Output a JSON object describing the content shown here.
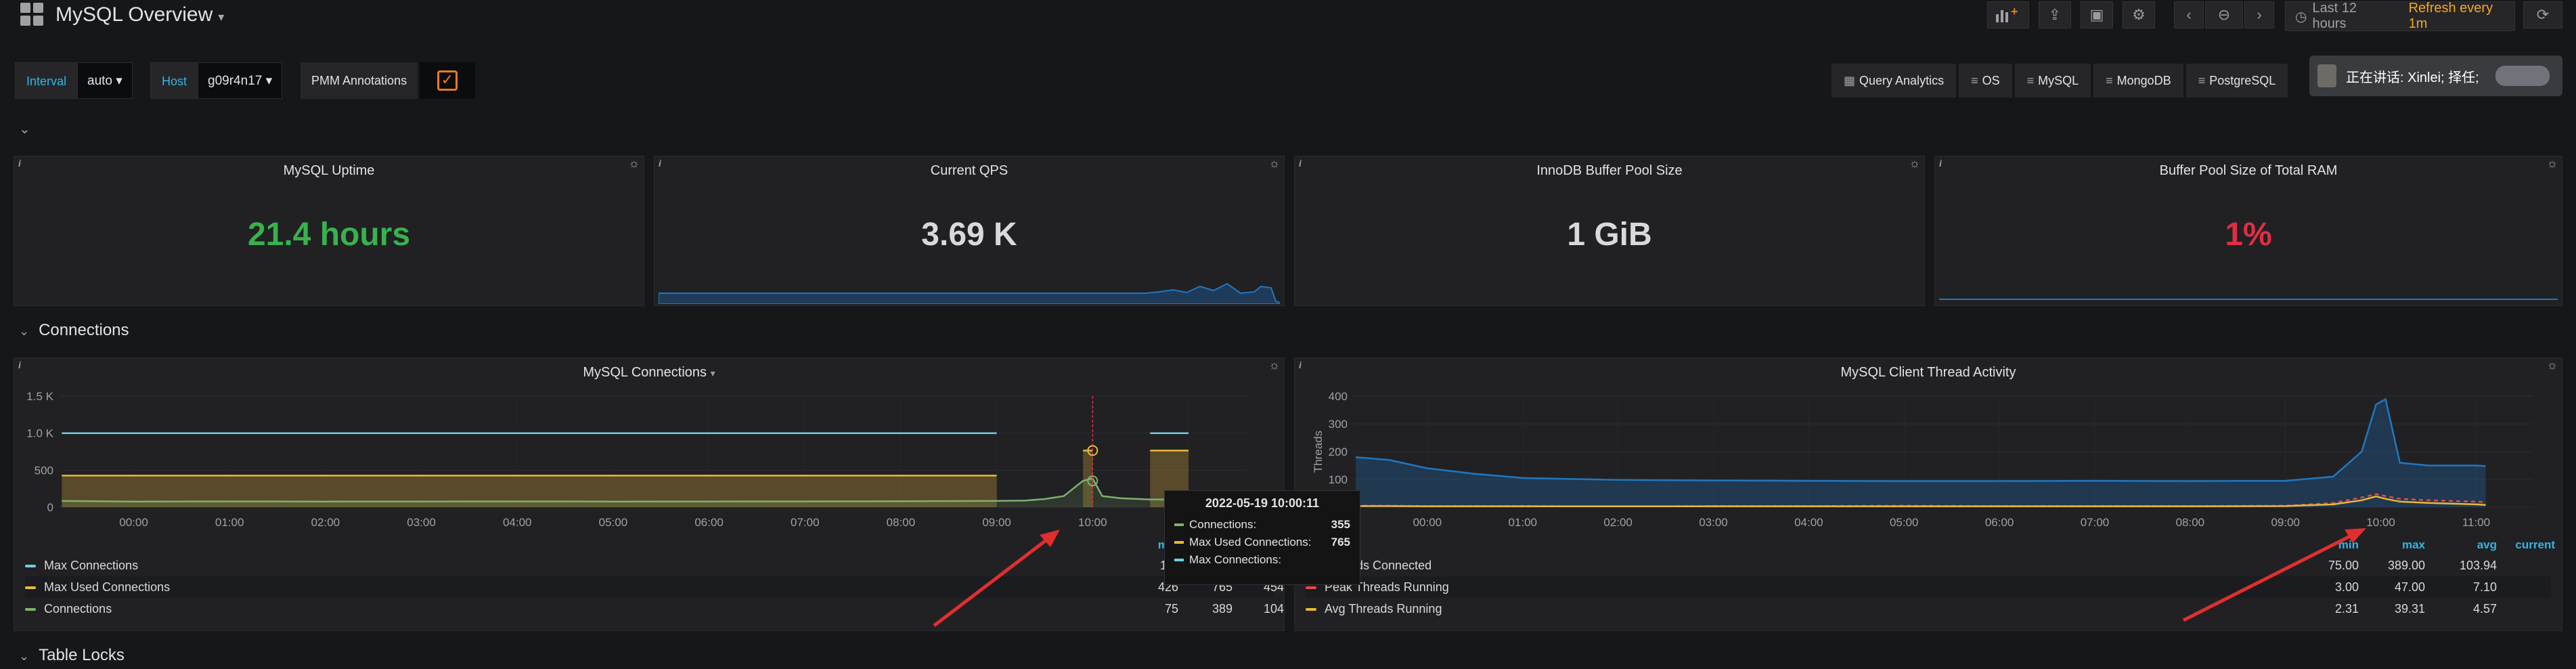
{
  "header": {
    "title": "MySQL Overview",
    "time_range": "Last 12 hours",
    "refresh": "Refresh every 1m"
  },
  "variables": {
    "interval_label": "Interval",
    "interval_value": "auto",
    "host_label": "Host",
    "host_value": "g09r4n17",
    "annotations_label": "PMM Annotations"
  },
  "nav_links": [
    "Query Analytics",
    "OS",
    "MySQL",
    "MongoDB",
    "PostgreSQL"
  ],
  "video_overlay": "正在讲话: Xinlei; 择任;",
  "stats": [
    {
      "title": "MySQL Uptime",
      "value": "21.4 hours",
      "color": "#37b24d"
    },
    {
      "title": "Current QPS",
      "value": "3.69 K",
      "color": "#d8d9da"
    },
    {
      "title": "InnoDB Buffer Pool Size",
      "value": "1 GiB",
      "color": "#d8d9da"
    },
    {
      "title": "Buffer Pool Size of Total RAM",
      "value": "1%",
      "color": "#e02f44"
    }
  ],
  "rows": {
    "connections": "Connections",
    "table_locks": "Table Locks"
  },
  "chart_data": [
    {
      "type": "line",
      "title": "MySQL Connections",
      "y_ticks": [
        "1.5 K",
        "1.0 K",
        "500",
        "0"
      ],
      "ylim": [
        0,
        1500
      ],
      "x_ticks": [
        "00:00",
        "01:00",
        "02:00",
        "03:00",
        "04:00",
        "05:00",
        "06:00",
        "07:00",
        "08:00",
        "09:00",
        "10:00",
        "11:00"
      ],
      "x_hours": [
        -0.75,
        0,
        1,
        2,
        3,
        4,
        5,
        6,
        7,
        8,
        9,
        9.3,
        9.5,
        9.7,
        9.9,
        10.0,
        10.1,
        10.3,
        10.6,
        11.0,
        11.2
      ],
      "series": [
        {
          "name": "Max Connections",
          "color": "#6ed0e0",
          "values": [
            1000,
            1000,
            1000,
            1000,
            1000,
            1000,
            1000,
            1000,
            1000,
            1000,
            1000,
            null,
            null,
            null,
            null,
            null,
            null,
            null,
            1000,
            1000,
            null
          ]
        },
        {
          "name": "Max Used Connections",
          "color": "#eab839",
          "values": [
            426,
            426,
            426,
            426,
            426,
            426,
            426,
            426,
            426,
            426,
            426,
            null,
            454,
            null,
            765,
            765,
            null,
            null,
            765,
            765,
            null
          ]
        },
        {
          "name": "Connections",
          "color": "#7eb26d",
          "values": [
            85,
            75,
            78,
            76,
            77,
            78,
            76,
            77,
            78,
            80,
            85,
            90,
            110,
            150,
            355,
            389,
            150,
            120,
            104,
            104,
            104
          ]
        }
      ],
      "legend_headers": [
        "min",
        "max",
        "avg"
      ],
      "legend": [
        {
          "name": "Max Connections",
          "min": "1 K",
          "max": "1 K",
          "avg": "1 K"
        },
        {
          "name": "Max Used Connections",
          "min": "426",
          "max": "765",
          "avg": "454"
        },
        {
          "name": "Connections",
          "min": "75",
          "max": "389",
          "avg": "104"
        }
      ],
      "tooltip": {
        "time": "2022-05-19 10:00:11",
        "items": [
          {
            "name": "Connections:",
            "value": "355",
            "color": "#7eb26d"
          },
          {
            "name": "Max Used Connections:",
            "value": "765",
            "color": "#eab839"
          },
          {
            "name": "Max Connections:",
            "value": "",
            "color": "#6ed0e0"
          }
        ]
      }
    },
    {
      "type": "line",
      "title": "MySQL Client Thread Activity",
      "ylabel": "Threads",
      "y_ticks": [
        "400",
        "300",
        "200",
        "100",
        "0"
      ],
      "ylim": [
        0,
        400
      ],
      "x_ticks": [
        "00:00",
        "01:00",
        "02:00",
        "03:00",
        "04:00",
        "05:00",
        "06:00",
        "07:00",
        "08:00",
        "09:00",
        "10:00",
        "11:00"
      ],
      "x_hours": [
        -0.75,
        -0.4,
        0,
        0.5,
        1,
        2,
        3,
        4,
        5,
        6,
        7,
        8,
        9,
        9.5,
        9.8,
        9.95,
        10.05,
        10.2,
        10.5,
        11.0,
        11.1
      ],
      "series": [
        {
          "name": "Threads Connected",
          "color": "#1f78c1",
          "values": [
            180,
            170,
            140,
            120,
            105,
            98,
            96,
            95,
            94,
            94,
            95,
            94,
            95,
            110,
            200,
            370,
            389,
            160,
            150,
            150,
            148
          ]
        },
        {
          "name": "Peak Threads Running",
          "color": "#e24d42",
          "values": [
            5,
            5,
            4,
            4,
            4,
            3,
            4,
            4,
            5,
            4,
            4,
            4,
            5,
            15,
            35,
            47,
            40,
            30,
            25,
            20,
            18
          ]
        },
        {
          "name": "Avg Threads Running",
          "color": "#eab839",
          "values": [
            4,
            4,
            3,
            3,
            3,
            3,
            3,
            3,
            3,
            3,
            3,
            3,
            4,
            10,
            25,
            39,
            30,
            20,
            15,
            10,
            8
          ]
        }
      ],
      "legend_headers": [
        "min",
        "max",
        "avg",
        "current"
      ],
      "legend": [
        {
          "name": "Threads Connected",
          "min": "75.00",
          "max": "389.00",
          "avg": "103.94"
        },
        {
          "name": "Peak Threads Running",
          "min": "3.00",
          "max": "47.00",
          "avg": "7.10"
        },
        {
          "name": "Avg Threads Running",
          "min": "2.31",
          "max": "39.31",
          "avg": "4.57"
        }
      ]
    }
  ]
}
